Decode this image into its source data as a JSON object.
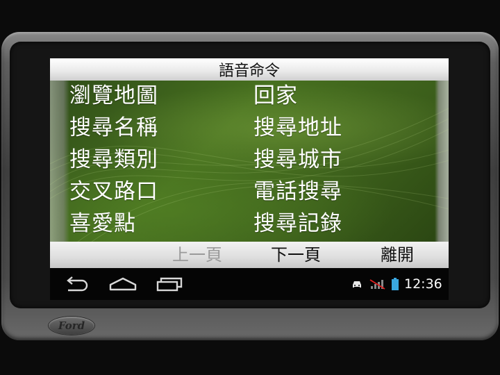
{
  "screen": {
    "title": "語音命令",
    "commands_left": [
      "瀏覽地圖",
      "搜尋名稱",
      "搜尋類別",
      "交叉路口",
      "喜愛點"
    ],
    "commands_right": [
      "回家",
      "搜尋地址",
      "搜尋城市",
      "電話搜尋",
      "搜尋記錄"
    ]
  },
  "nav": {
    "prev": "上一頁",
    "next": "下一頁",
    "exit": "離開"
  },
  "status_bar": {
    "time": "12:36",
    "icons": [
      "back-icon",
      "home-icon",
      "recent-apps-icon",
      "car-icon",
      "signal-icon",
      "battery-icon"
    ]
  },
  "device": {
    "logo": "Ford"
  },
  "colors": {
    "screen_green": "#3c5f1b",
    "text": "#ffffff",
    "disabled": "#9a9a9a"
  }
}
